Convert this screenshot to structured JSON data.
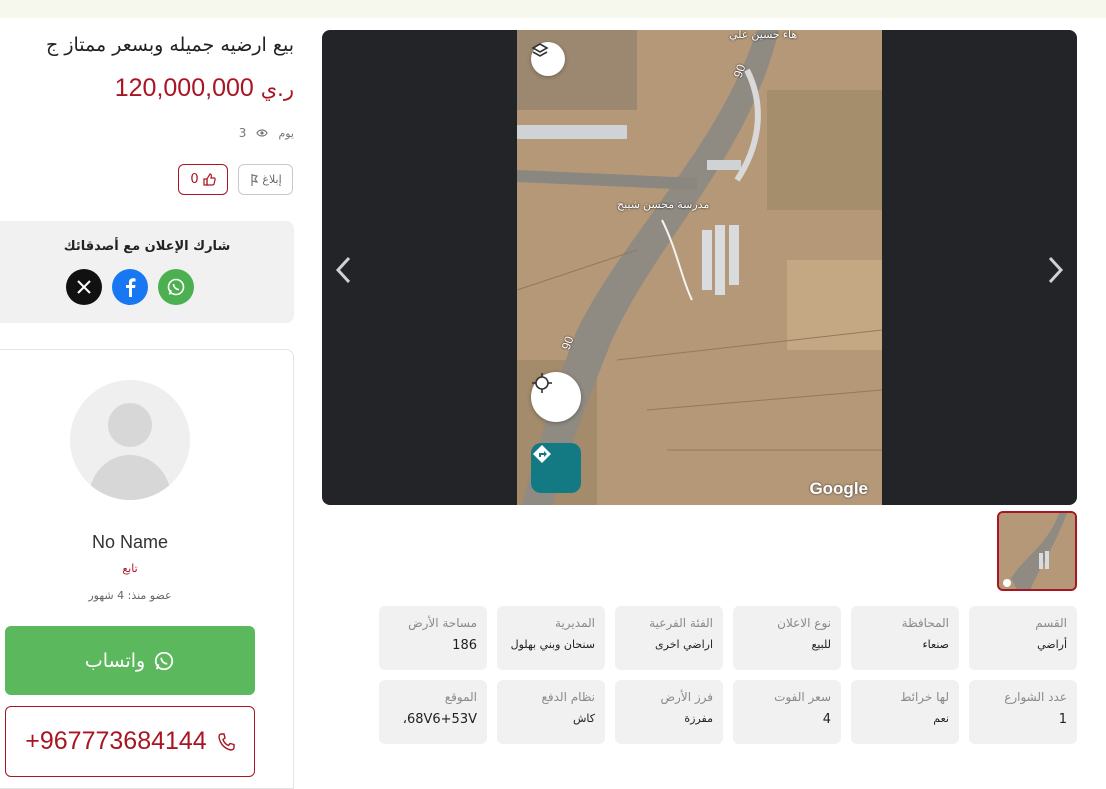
{
  "listing": {
    "title": "بيع ارضيه جميله وبسعر ممتاز ج",
    "price_value": "120,000,000",
    "currency": "ر.ي",
    "views_count": "3",
    "views_unit": "يوم",
    "like_count": "0",
    "report_label": "إبلاغ"
  },
  "share": {
    "title": "شارك الإعلان مع أصدقائك",
    "icons": [
      "x-icon",
      "facebook-icon",
      "whatsapp-icon"
    ]
  },
  "seller": {
    "name": "No Name",
    "role": "تابع",
    "member_since": "عضو منذ: 4 شهور",
    "whatsapp_label": "واتساب",
    "phone": "+967773684144"
  },
  "map": {
    "road_label_top": "90",
    "road_label_mid": "90",
    "place_label": "مدرسة محسن شيبح",
    "top_label": "هاء حسين علي",
    "google_logo": "Google"
  },
  "attributes": [
    {
      "label": "القسم",
      "value": "أراضي"
    },
    {
      "label": "المحافظة",
      "value": "صنعاء"
    },
    {
      "label": "نوع الاعلان",
      "value": "للبيع"
    },
    {
      "label": "الفئة الفرعية",
      "value": "اراضي اخرى"
    },
    {
      "label": "المديرية",
      "value": "سنحان وبني بهلول"
    },
    {
      "label": "مساحة الأرض",
      "value": "186"
    },
    {
      "label": "عدد الشوارع",
      "value": "1"
    },
    {
      "label": "لها خرائط",
      "value": "نعم"
    },
    {
      "label": "سعر الفوت",
      "value": "4"
    },
    {
      "label": "فرز الأرض",
      "value": "مفرزة"
    },
    {
      "label": "نظام الدفع",
      "value": "كاش"
    },
    {
      "label": "الموقع",
      "value": "68V6+53V،"
    }
  ],
  "colors": {
    "brand": "#a81523",
    "whatsapp": "#5cb85c",
    "gallery_bg": "#222428",
    "attr_bg": "#f1f1f1"
  }
}
